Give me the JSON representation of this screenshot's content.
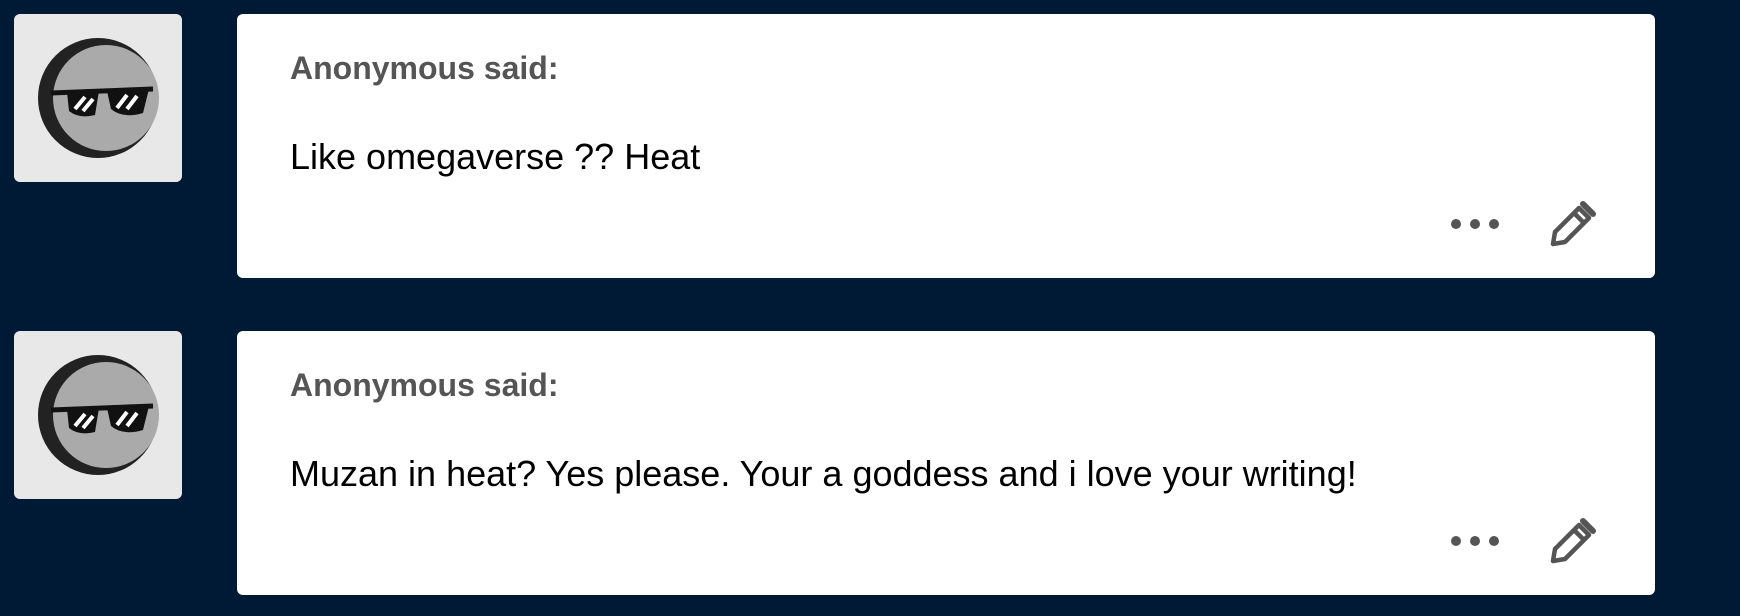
{
  "messages": [
    {
      "asker": "Anonymous said:",
      "question": "Like omegaverse ?? Heat",
      "avatar_icon": "sunglasses-moon-avatar-icon",
      "more_icon": "ellipsis-icon",
      "edit_icon": "pencil-icon"
    },
    {
      "asker": "Anonymous said:",
      "question": "Muzan in heat? Yes please. Your a goddess and i love your writing!",
      "avatar_icon": "sunglasses-moon-avatar-icon",
      "more_icon": "ellipsis-icon",
      "edit_icon": "pencil-icon"
    }
  ],
  "colors": {
    "background": "#001935",
    "card": "#ffffff",
    "avatar_bg": "#e8e8e8",
    "asker_text": "#555555",
    "icon": "#555555"
  }
}
